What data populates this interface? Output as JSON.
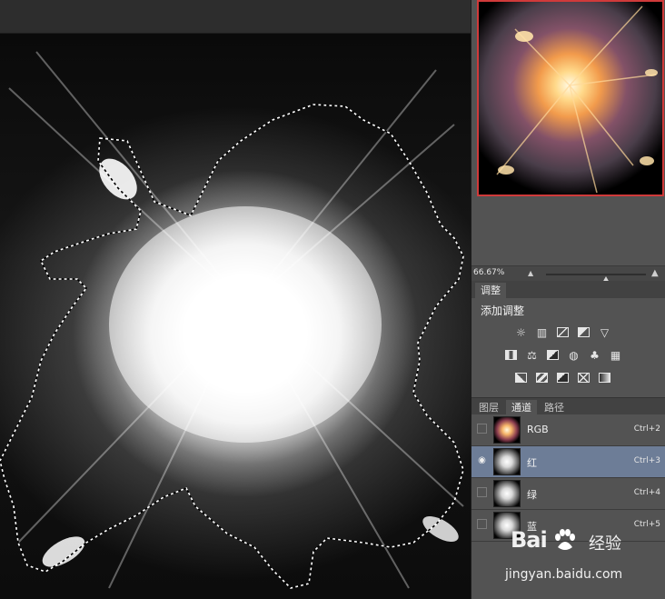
{
  "navigator": {
    "zoom_value": "66.67%",
    "zoom_level_fraction": 0.6
  },
  "adjustments": {
    "tab_label": "调整",
    "title": "添加调整",
    "icons_row1": [
      "brightness-contrast-icon",
      "levels-icon",
      "curves-icon",
      "exposure-icon",
      "vibrance-icon"
    ],
    "icons_row2": [
      "hue-saturation-icon",
      "color-balance-icon",
      "black-white-icon",
      "photo-filter-icon",
      "channel-mixer-icon",
      "color-lookup-icon"
    ],
    "icons_row3": [
      "invert-icon",
      "posterize-icon",
      "threshold-icon",
      "selective-color-icon",
      "gradient-map-icon"
    ]
  },
  "layers_panel": {
    "tabs": [
      {
        "label": "图层",
        "active": false
      },
      {
        "label": "通道",
        "active": true
      },
      {
        "label": "路径",
        "active": false
      }
    ]
  },
  "channels": [
    {
      "name": "RGB",
      "shortcut": "Ctrl+2",
      "selected": false,
      "thumb": "rgb"
    },
    {
      "name": "红",
      "shortcut": "Ctrl+3",
      "selected": true,
      "thumb": "gray"
    },
    {
      "name": "绿",
      "shortcut": "Ctrl+4",
      "selected": false,
      "thumb": "gray"
    },
    {
      "name": "蓝",
      "shortcut": "Ctrl+5",
      "selected": false,
      "thumb": "gray"
    }
  ],
  "watermark": {
    "logo_text_a": "Bai",
    "logo_text_b": "经验",
    "url": "jingyan.baidu.com"
  },
  "colors": {
    "panel_bg": "#535353",
    "selected_row": "#6d7d97",
    "navigator_frame": "#d03a3a"
  }
}
